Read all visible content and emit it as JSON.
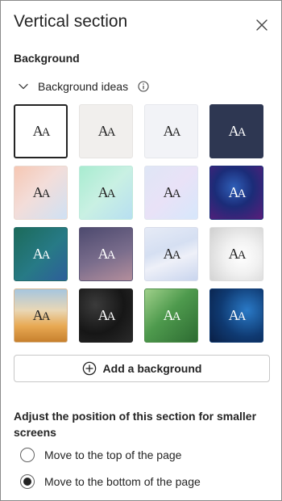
{
  "panel": {
    "title": "Vertical section",
    "close_icon": "close-icon"
  },
  "background": {
    "heading": "Background",
    "ideas_label": "Background ideas",
    "ideas_expanded": true,
    "tile_glyph": "AA",
    "tiles": [
      {
        "name": "white",
        "selected": true
      },
      {
        "name": "light-gray"
      },
      {
        "name": "pale-blue-gray"
      },
      {
        "name": "navy"
      },
      {
        "name": "peach-gradient"
      },
      {
        "name": "mint-gradient"
      },
      {
        "name": "lavender-gradient"
      },
      {
        "name": "deep-blue-purple"
      },
      {
        "name": "teal-green"
      },
      {
        "name": "dusky-purple"
      },
      {
        "name": "light-blue-wave"
      },
      {
        "name": "white-foliage"
      },
      {
        "name": "golden-bokeh"
      },
      {
        "name": "black-swirl"
      },
      {
        "name": "green-leaf"
      },
      {
        "name": "blue-network"
      }
    ],
    "add_button_label": "Add a background"
  },
  "position": {
    "heading": "Adjust the position of this section for smaller screens",
    "options": [
      {
        "label": "Move to the top of the page",
        "checked": false
      },
      {
        "label": "Move to the bottom of the page",
        "checked": true
      }
    ]
  }
}
